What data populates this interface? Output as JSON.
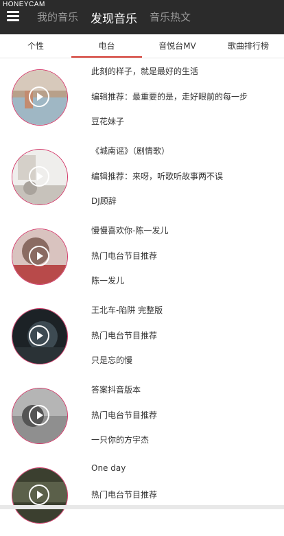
{
  "watermark": "HONEYCAM",
  "header": {
    "nav": [
      {
        "label": "我的音乐",
        "active": false
      },
      {
        "label": "发现音乐",
        "active": true
      },
      {
        "label": "音乐热文",
        "active": false
      }
    ]
  },
  "tabs": [
    {
      "label": "个性",
      "active": false
    },
    {
      "label": "电台",
      "active": true
    },
    {
      "label": "音悦台MV",
      "active": false
    },
    {
      "label": "歌曲排行榜",
      "active": false
    }
  ],
  "items": [
    {
      "title": "此刻的样子，就是最好的生活",
      "desc": "编辑推荐：最重要的是，走好眼前的每一步",
      "author": "豆花妹子",
      "thumb_color": "#c9b8a6",
      "thumb_icon": "play-icon"
    },
    {
      "title": "《城南谣》（剧情歌）",
      "desc": "编辑推荐：来呀，听歌听故事两不误",
      "author": "DJ顾辞",
      "thumb_color": "#d8d4cf",
      "thumb_icon": "play-icon"
    },
    {
      "title": "慢慢喜欢你-陈一发儿",
      "desc": "热门电台节目推荐",
      "author": "陈一发儿",
      "thumb_color": "#b98a86",
      "thumb_icon": "play-icon"
    },
    {
      "title": "王北车-陷阱 完整版",
      "desc": "热门电台节目推荐",
      "author": "只是忘的慢",
      "thumb_color": "#1e2428",
      "thumb_icon": "play-icon"
    },
    {
      "title": "答案抖音版本",
      "desc": "热门电台节目推荐",
      "author": "一只你的方宇杰",
      "thumb_color": "#7c7c7c",
      "thumb_icon": "play-icon"
    },
    {
      "title": "One day",
      "desc": "热门电台节目推荐",
      "author": "",
      "thumb_color": "#3b3f2f",
      "thumb_icon": "play-icon"
    }
  ]
}
